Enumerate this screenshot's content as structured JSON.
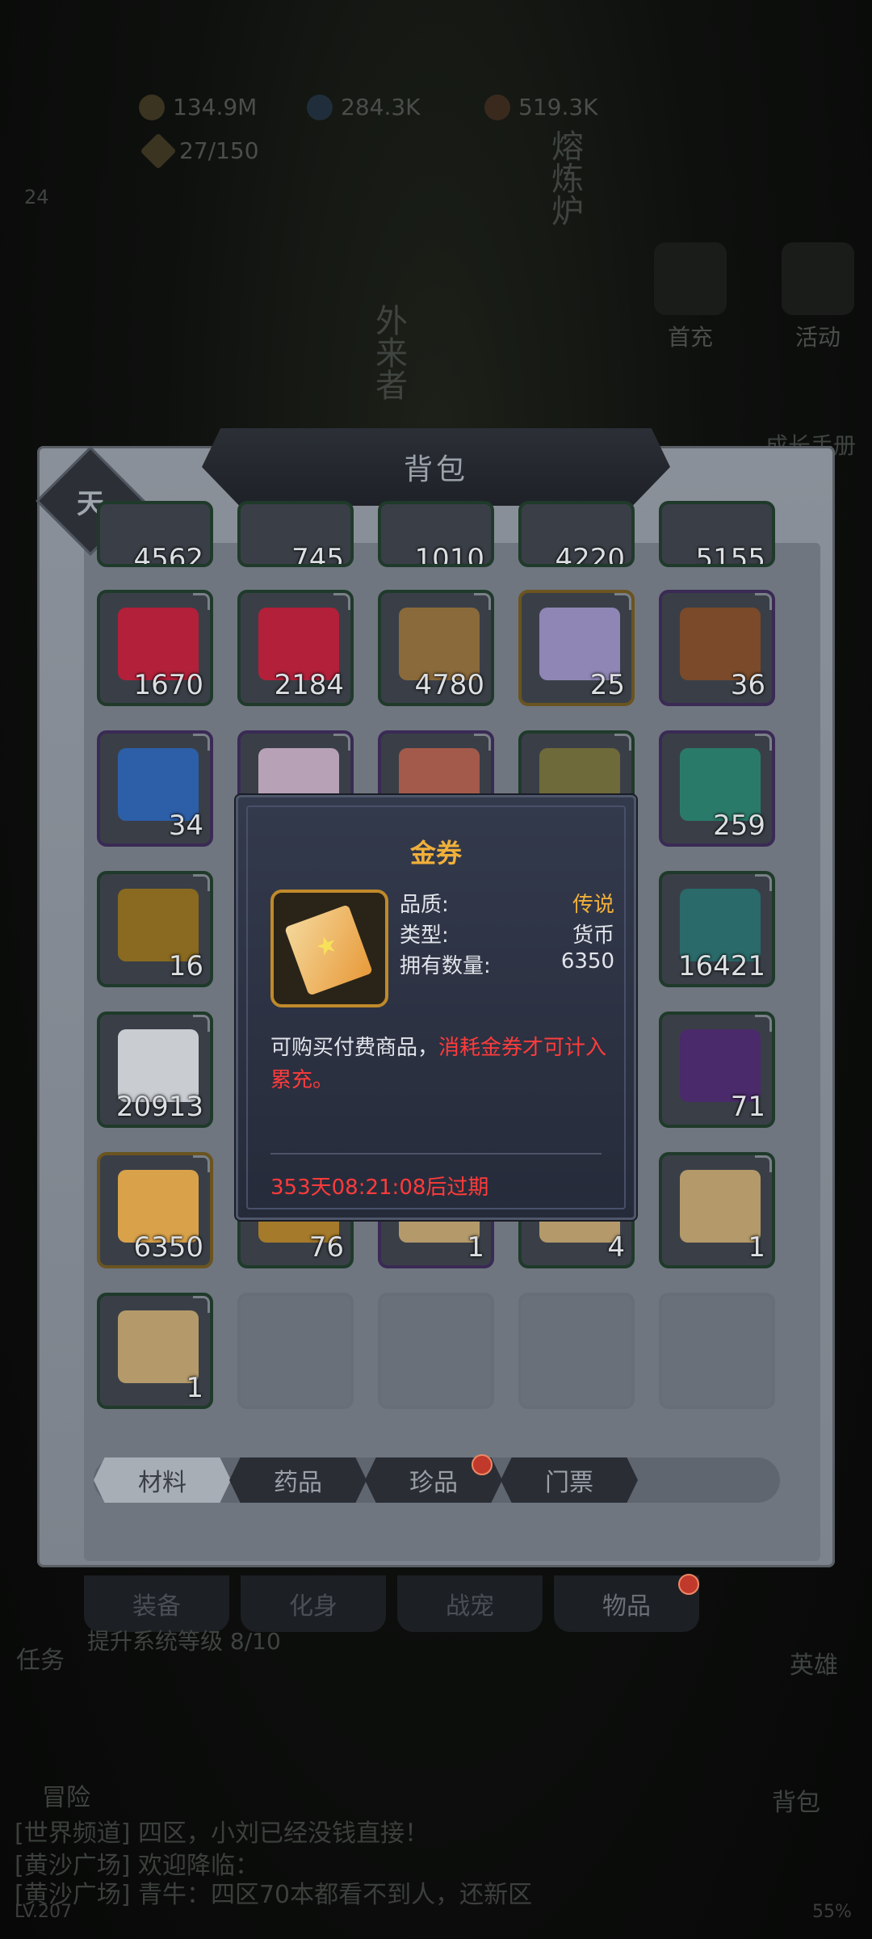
{
  "top": {
    "gold": "134.9M",
    "diamonds": "284.3K",
    "essence": "519.3K",
    "stamina": "27/150",
    "level": "24",
    "furnace": "熔炼炉",
    "outsider": "外来者",
    "first_charge": "首充",
    "activity": "活动",
    "growth": "成长手册"
  },
  "panel": {
    "title": "背包",
    "badge": "天",
    "partial_row": [
      "4562",
      "745",
      "1010",
      "4220",
      "5155"
    ],
    "rows": [
      [
        {
          "qty": "1670",
          "rarity": "green",
          "icon": "red-crystal"
        },
        {
          "qty": "2184",
          "rarity": "green",
          "icon": "red-crystal"
        },
        {
          "qty": "4780",
          "rarity": "green",
          "icon": "parchment"
        },
        {
          "qty": "25",
          "rarity": "gold",
          "icon": "purple-gem"
        },
        {
          "qty": "36",
          "rarity": "purple",
          "icon": "treasure-pot"
        }
      ],
      [
        {
          "qty": "34",
          "rarity": "purple",
          "icon": "blue-orb"
        },
        {
          "qty": "",
          "rarity": "purple",
          "icon": "pink-crystal"
        },
        {
          "qty": "",
          "rarity": "purple",
          "icon": "relic"
        },
        {
          "qty": "",
          "rarity": "green",
          "icon": "amulet"
        },
        {
          "qty": "259",
          "rarity": "purple",
          "icon": "green-crystal"
        }
      ],
      [
        {
          "qty": "16",
          "rarity": "green",
          "icon": "gold-coin"
        },
        {
          "qty": "",
          "rarity": "green",
          "icon": "hidden"
        },
        {
          "qty": "",
          "rarity": "green",
          "icon": "hidden"
        },
        {
          "qty": "",
          "rarity": "green",
          "icon": "hidden"
        },
        {
          "qty": "16421",
          "rarity": "green",
          "icon": "teal-crystal"
        }
      ],
      [
        {
          "qty": "20913",
          "rarity": "green",
          "icon": "white-powder"
        },
        {
          "qty": "",
          "rarity": "green",
          "icon": "hidden"
        },
        {
          "qty": "",
          "rarity": "green",
          "icon": "hidden"
        },
        {
          "qty": "",
          "rarity": "green",
          "icon": "hidden"
        },
        {
          "qty": "71",
          "rarity": "green",
          "icon": "purple-cube"
        }
      ],
      [
        {
          "qty": "6350",
          "rarity": "gold",
          "icon": "gold-ticket"
        },
        {
          "qty": "76",
          "rarity": "green",
          "icon": "gold-ring"
        },
        {
          "qty": "1",
          "rarity": "purple",
          "icon": "scroll"
        },
        {
          "qty": "4",
          "rarity": "green",
          "icon": "scroll"
        },
        {
          "qty": "1",
          "rarity": "green",
          "icon": "scroll"
        }
      ],
      [
        {
          "qty": "1",
          "rarity": "green",
          "icon": "scroll"
        },
        {
          "qty": "",
          "rarity": "empty",
          "icon": ""
        },
        {
          "qty": "",
          "rarity": "empty",
          "icon": ""
        },
        {
          "qty": "",
          "rarity": "empty",
          "icon": ""
        },
        {
          "qty": "",
          "rarity": "empty",
          "icon": ""
        }
      ]
    ],
    "tabs": [
      "材料",
      "药品",
      "珍品",
      "门票"
    ],
    "active_tab": 0
  },
  "bottom_tabs": [
    "装备",
    "化身",
    "战宠",
    "物品"
  ],
  "tooltip": {
    "title": "金券",
    "quality_label": "品质:",
    "quality_value": "传说",
    "type_label": "类型:",
    "type_value": "货币",
    "count_label": "拥有数量:",
    "count_value": "6350",
    "desc_plain": "可购买付费商品，",
    "desc_red": "消耗金券才可计入累充。",
    "expire": "353天08:21:08后过期"
  },
  "left_menu": {
    "task": "任务",
    "task_progress": "提升系统等级 8/10",
    "adventure": "冒险"
  },
  "right_menu": {
    "hero": "英雄",
    "bag": "背包"
  },
  "chat": {
    "line1": "[世界频道] 四区，小刘已经没钱直接！",
    "line2": "[黄沙广场] 欢迎降临：",
    "line3": "[黄沙广场] 青牛：四区70本都看不到人，还新区",
    "level": "LV.207",
    "percent": "55%"
  },
  "colors": {
    "gold": "#f0b03a",
    "red": "#ff3b3b"
  }
}
